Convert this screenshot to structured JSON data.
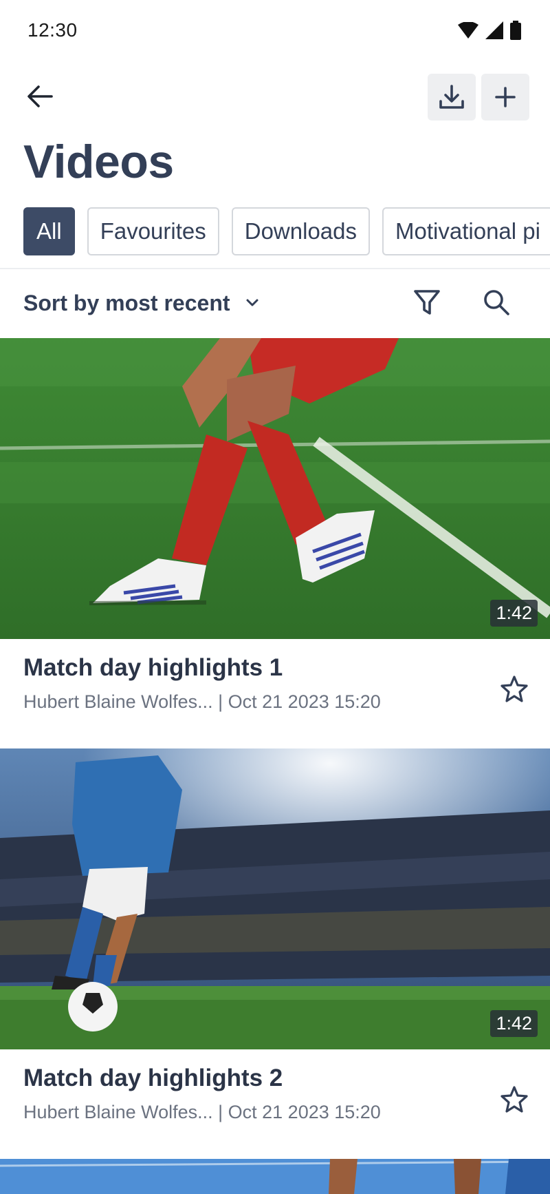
{
  "status_bar": {
    "time": "12:30"
  },
  "header": {
    "title": "Videos"
  },
  "chips": [
    {
      "label": "All",
      "active": true
    },
    {
      "label": "Favourites",
      "active": false
    },
    {
      "label": "Downloads",
      "active": false
    },
    {
      "label": "Motivational pi",
      "active": false
    }
  ],
  "sort": {
    "label": "Sort by most recent"
  },
  "videos": [
    {
      "title": "Match day highlights 1",
      "meta": "Hubert Blaine Wolfes... | Oct 21 2023 15:20",
      "duration": "1:42"
    },
    {
      "title": "Match day highlights 2",
      "meta": "Hubert Blaine Wolfes... | Oct 21 2023 15:20",
      "duration": "1:42"
    }
  ],
  "icons": {
    "back": "arrow-left-icon",
    "download": "download-icon",
    "add": "plus-icon",
    "sort": "chevron-down-icon",
    "filter": "filter-icon",
    "search": "search-icon",
    "favourite": "star-outline-icon"
  },
  "colors": {
    "primary": "#333f57",
    "chip_active_bg": "#3d4b66",
    "chip_border": "#d4d7dc",
    "meta_text": "#6b7280"
  }
}
